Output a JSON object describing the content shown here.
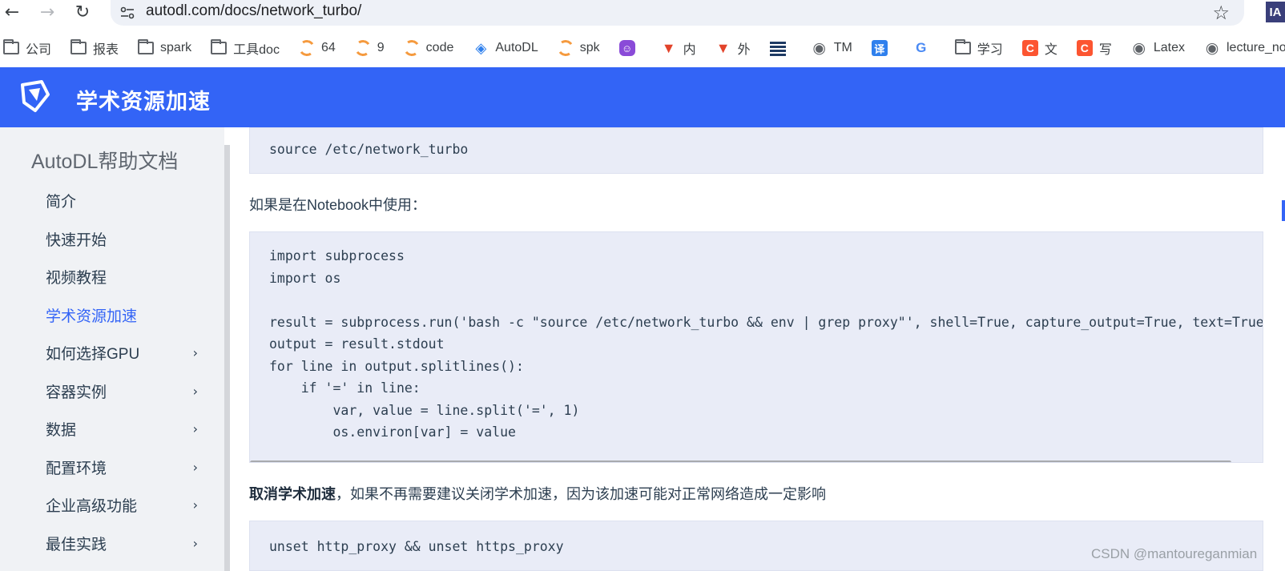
{
  "browser": {
    "url": "autodl.com/docs/network_turbo/",
    "profile_badge": "IA",
    "bookmarks": [
      {
        "label": "公司",
        "icon": "folder-icon"
      },
      {
        "label": "报表",
        "icon": "folder-icon"
      },
      {
        "label": "spark",
        "icon": "folder-icon"
      },
      {
        "label": "工具doc",
        "icon": "folder-icon"
      },
      {
        "label": "64",
        "icon": "ring-icon"
      },
      {
        "label": "9",
        "icon": "ring-icon"
      },
      {
        "label": "code",
        "icon": "ring-icon"
      },
      {
        "label": "AutoDL",
        "icon": "autodl-icon"
      },
      {
        "label": "spk",
        "icon": "ring-icon"
      },
      {
        "label": "",
        "icon": "chat-icon"
      },
      {
        "label": "内",
        "icon": "gitlab-icon"
      },
      {
        "label": "外",
        "icon": "gitlab-icon"
      },
      {
        "label": "",
        "icon": "stripes-icon"
      },
      {
        "label": "TM",
        "icon": "globe-icon"
      },
      {
        "label": "",
        "icon": "translate-icon",
        "glyph": "译"
      },
      {
        "label": "",
        "icon": "google-translate-icon"
      },
      {
        "label": "学习",
        "icon": "folder-icon"
      },
      {
        "label": "文",
        "icon": "csdn-icon",
        "glyph": "C"
      },
      {
        "label": "写",
        "icon": "csdn-icon",
        "glyph": "C"
      },
      {
        "label": "Latex",
        "icon": "globe-icon"
      },
      {
        "label": "lecture_no",
        "icon": "globe-icon"
      }
    ]
  },
  "header": {
    "title": "学术资源加速"
  },
  "sidebar": {
    "title": "AutoDL帮助文档",
    "items": [
      {
        "label": "简介",
        "expandable": false,
        "active": false
      },
      {
        "label": "快速开始",
        "expandable": false,
        "active": false
      },
      {
        "label": "视频教程",
        "expandable": false,
        "active": false
      },
      {
        "label": "学术资源加速",
        "expandable": false,
        "active": true
      },
      {
        "label": "如何选择GPU",
        "expandable": true,
        "active": false
      },
      {
        "label": "容器实例",
        "expandable": true,
        "active": false
      },
      {
        "label": "数据",
        "expandable": true,
        "active": false
      },
      {
        "label": "配置环境",
        "expandable": true,
        "active": false
      },
      {
        "label": "企业高级功能",
        "expandable": true,
        "active": false
      },
      {
        "label": "最佳实践",
        "expandable": true,
        "active": false
      }
    ],
    "chevron": "›"
  },
  "content": {
    "code1": [
      "source /etc/network_turbo"
    ],
    "para1": "如果是在Notebook中使用：",
    "code2": [
      "import subprocess",
      "import os",
      "",
      "result = subprocess.run('bash -c \"source /etc/network_turbo && env | grep proxy\"', shell=True, capture_output=True, text=True)",
      "output = result.stdout",
      "for line in output.splitlines():",
      "    if '=' in line:",
      "        var, value = line.split('=', 1)",
      "        os.environ[var] = value"
    ],
    "para2_bold": "取消学术加速",
    "para2_rest": "，如果不再需要建议关闭学术加速，因为该加速可能对正常网络造成一定影响",
    "code3": [
      "unset http_proxy && unset https_proxy"
    ]
  },
  "watermark": "CSDN @mantoureganmian",
  "colors": {
    "brand": "#3364f6",
    "code_bg": "#e9ecf7",
    "sidebar_bg": "#f0f2f5"
  }
}
